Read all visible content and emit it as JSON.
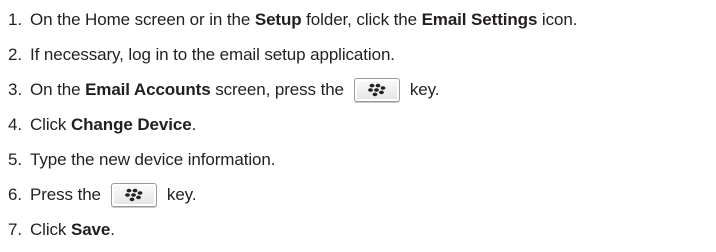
{
  "steps": [
    {
      "num": "1.",
      "parts": [
        "On the Home screen or in the ",
        "Setup",
        " folder, click the ",
        "Email Settings",
        " icon."
      ]
    },
    {
      "num": "2.",
      "parts": [
        "If necessary, log in to the email setup application."
      ]
    },
    {
      "num": "3.",
      "parts": [
        "On the ",
        "Email Accounts",
        " screen, press the",
        "key."
      ]
    },
    {
      "num": "4.",
      "parts": [
        "Click ",
        "Change Device",
        "."
      ]
    },
    {
      "num": "5.",
      "parts": [
        "Type the new device information."
      ]
    },
    {
      "num": "6.",
      "parts": [
        "Press the",
        "key."
      ]
    },
    {
      "num": "7.",
      "parts": [
        "Click ",
        "Save",
        "."
      ]
    }
  ],
  "icons": {
    "menu_key": "blackberry-menu-key-icon"
  },
  "colors": {
    "text": "#231f20",
    "key_border": "#9a9a9a"
  }
}
